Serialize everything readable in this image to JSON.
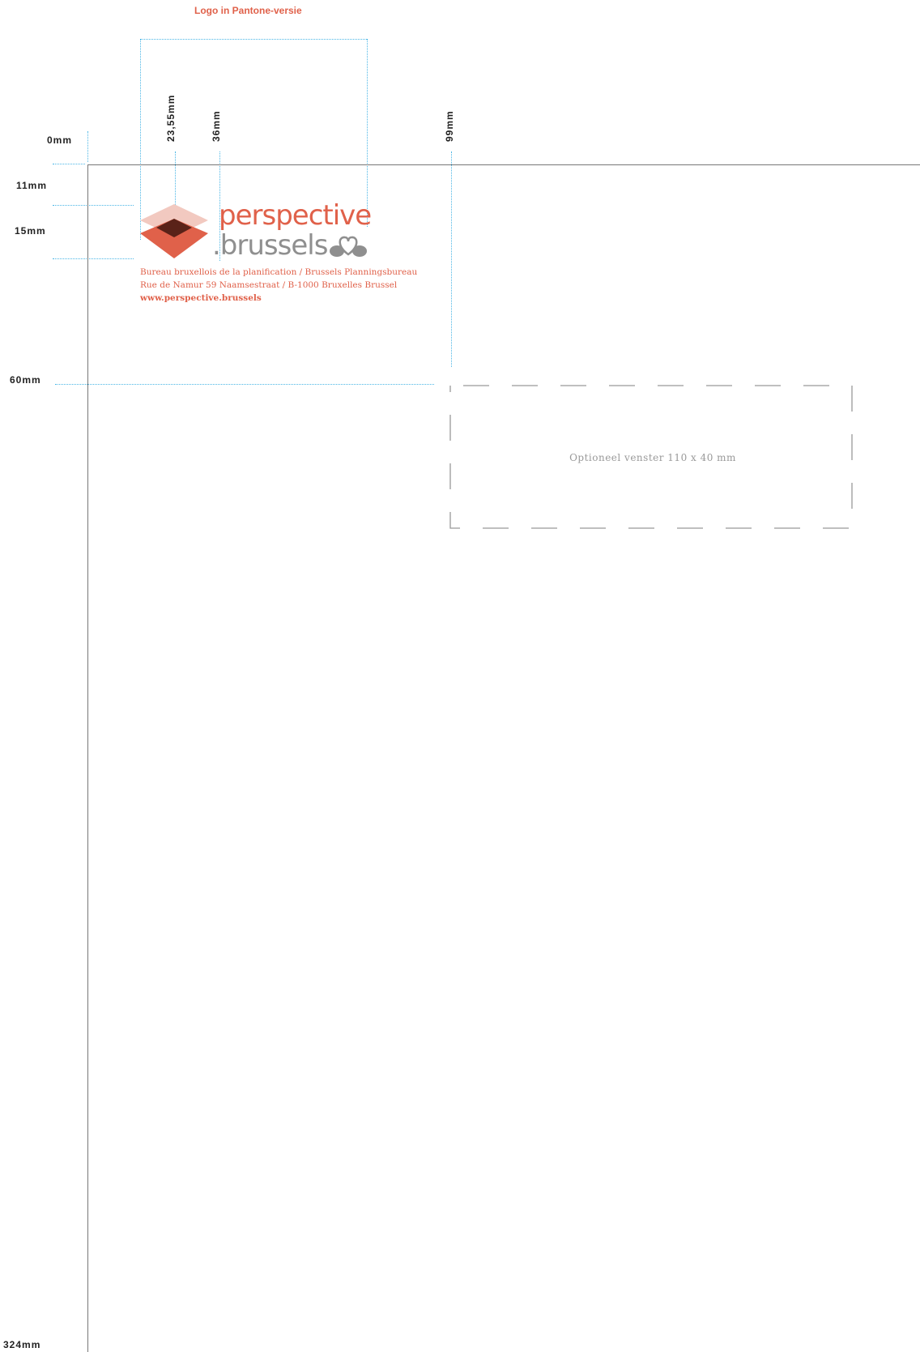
{
  "header": {
    "title": "Logo in Pantone-versie"
  },
  "dimensions": {
    "top_0": "0mm",
    "top_11": "11mm",
    "top_15": "15mm",
    "top_60": "60mm",
    "bottom": "324mm",
    "left_23_55": "23,55mm",
    "left_36": "36mm",
    "left_99": "99mm"
  },
  "logo": {
    "line1": "perspective",
    "line2": ".brussels",
    "colors": {
      "accent": "#e0614a",
      "light": "#f2c9c0",
      "dark": "#5a2218",
      "grey": "#8f8f8f"
    }
  },
  "address": {
    "line1": "Bureau bruxellois de la planification / Brussels Planningsbureau",
    "line2": "Rue de Namur 59 Naamsestraat / B-1000 Bruxelles Brussel",
    "url": "www.perspective.brussels"
  },
  "window": {
    "label": "Optioneel venster 110 x 40 mm"
  },
  "colors": {
    "guide": "#4bb6e6",
    "page_border": "#777777",
    "title": "#e0614a"
  }
}
